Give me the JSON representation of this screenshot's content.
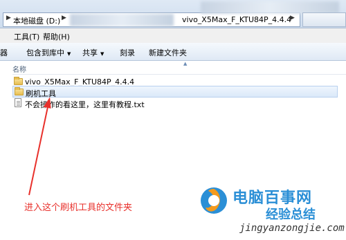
{
  "address_bar": {
    "crumb_drive": "本地磁盘 (D:)",
    "crumb_folder": "vivo_X5Max_F_KTU84P_4.4.4"
  },
  "menu": {
    "tools": "工具(T)",
    "help": "帮助(H)"
  },
  "toolbar": {
    "organize_partial": "器",
    "include_library": "包含到库中",
    "share": "共享",
    "burn": "刻录",
    "new_folder": "新建文件夹"
  },
  "file_list": {
    "column_name": "名称",
    "items": [
      {
        "name": "vivo_X5Max_F_KTU84P_4.4.4",
        "type": "folder"
      },
      {
        "name": "刷机工具",
        "type": "folder",
        "selected": true
      },
      {
        "name": "不会操作的看这里，这里有教程.txt",
        "type": "text"
      }
    ]
  },
  "annotation": {
    "text": "进入这个刷机工具的文件夹",
    "color": "#e8302b"
  },
  "watermark": {
    "title": "电脑百事网",
    "subtitle": "经验总结",
    "url": "jingyanzongjie.com",
    "brand_color": "#2b8fd6"
  }
}
